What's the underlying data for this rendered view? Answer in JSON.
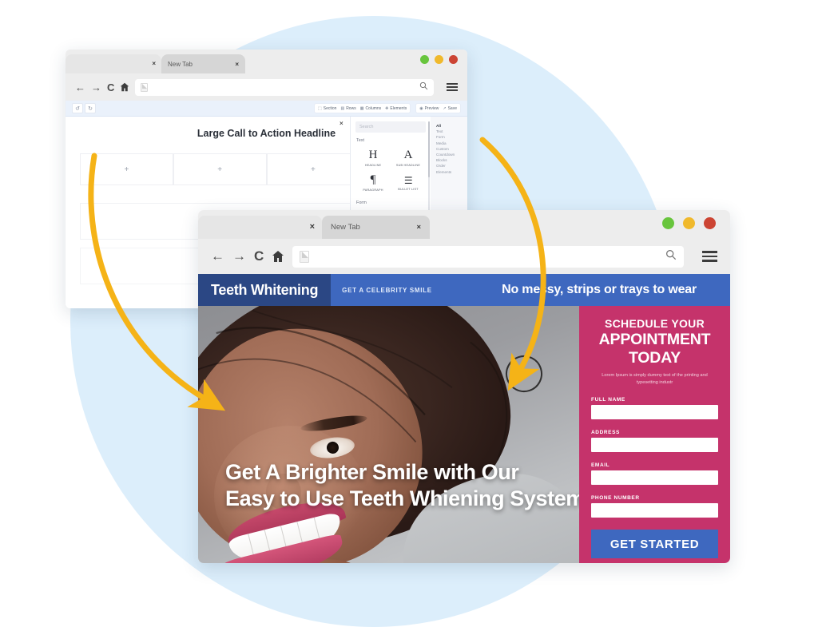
{
  "background": {
    "blob_color": "#dceefb"
  },
  "arrows": {
    "color": "#f5b317",
    "count": 2
  },
  "builder_window": {
    "tab": {
      "label": "New Tab",
      "close": "×",
      "ghost_close": "×"
    },
    "window_controls": {
      "minimize": "green",
      "maximize": "yellow",
      "close": "red"
    },
    "nav": {
      "back": "←",
      "forward": "→",
      "reload": "C",
      "home": "⌂"
    },
    "address_bar": {
      "value": "",
      "placeholder": ""
    },
    "toolbar": {
      "undo": "↺",
      "redo": "↻",
      "items": [
        {
          "label": "Section",
          "icon": "⬚"
        },
        {
          "label": "Rows",
          "icon": "▤"
        },
        {
          "label": "Columns",
          "icon": "▦"
        },
        {
          "label": "Elements",
          "icon": "✥"
        }
      ],
      "actions": [
        {
          "label": "Preview",
          "icon": "◉"
        },
        {
          "label": "Save",
          "icon": "↗"
        }
      ]
    },
    "canvas": {
      "headline": "Large Call to Action Headline",
      "columns": [
        {
          "plus": "+",
          "selected": false
        },
        {
          "plus": "+",
          "selected": false
        },
        {
          "plus": "+",
          "selected": false
        },
        {
          "plus": "+",
          "selected": true
        }
      ],
      "rows": [
        {
          "plus": "+"
        },
        {
          "plus": "+"
        }
      ]
    },
    "elements_panel": {
      "close": "×",
      "search_placeholder": "Search",
      "category_text": "Text",
      "category_form": "Form",
      "tiles": [
        {
          "glyph": "H",
          "label": "HEADLINE"
        },
        {
          "glyph": "A",
          "label": "SUB HEADLINE"
        },
        {
          "glyph": "¶",
          "label": "PARAGRAPH"
        },
        {
          "glyph": "☰",
          "label": "BULLET LIST"
        }
      ],
      "sidebar": [
        {
          "label": "All",
          "active": true
        },
        {
          "label": "Text",
          "active": false
        },
        {
          "label": "Form",
          "active": false
        },
        {
          "label": "Media",
          "active": false
        },
        {
          "label": "Custom",
          "active": false
        },
        {
          "label": "Countdown",
          "active": false
        },
        {
          "label": "Blocks",
          "active": false
        },
        {
          "label": "Order",
          "active": false
        },
        {
          "label": "Elements",
          "active": false
        }
      ]
    }
  },
  "preview_window": {
    "tab": {
      "label": "New Tab",
      "close": "×",
      "ghost_close": "×"
    },
    "window_controls": {
      "minimize": "green",
      "maximize": "yellow",
      "close": "red"
    },
    "nav": {
      "back": "←",
      "forward": "→",
      "reload": "C",
      "home": "⌂"
    },
    "address_bar": {
      "value": "",
      "placeholder": ""
    },
    "landing_page": {
      "brand": "Teeth Whitening",
      "kicker": "GET A CELEBRITY SMILE",
      "tagline": "No messy, strips or trays to wear",
      "hero_headline_line1": "Get A Brighter Smile with Our",
      "hero_headline_line2": "Easy to Use Teeth Whiening System",
      "form": {
        "subtitle": "SCHEDULE YOUR",
        "title": "APPOINTMENT TODAY",
        "lorem": "Lorem Ipsum is simply dummy text of the printing and typesetting industr",
        "fields": [
          {
            "label": "FULL NAME",
            "value": "",
            "placeholder": ""
          },
          {
            "label": "ADDRESS",
            "value": "",
            "placeholder": ""
          },
          {
            "label": "EMAIL",
            "value": "",
            "placeholder": ""
          },
          {
            "label": "PHONE NUMBER",
            "value": "",
            "placeholder": ""
          }
        ],
        "submit": "GET STARTED"
      },
      "colors": {
        "navy": "#2b4784",
        "blue": "#3e68bf",
        "pink": "#c5336b"
      }
    }
  }
}
